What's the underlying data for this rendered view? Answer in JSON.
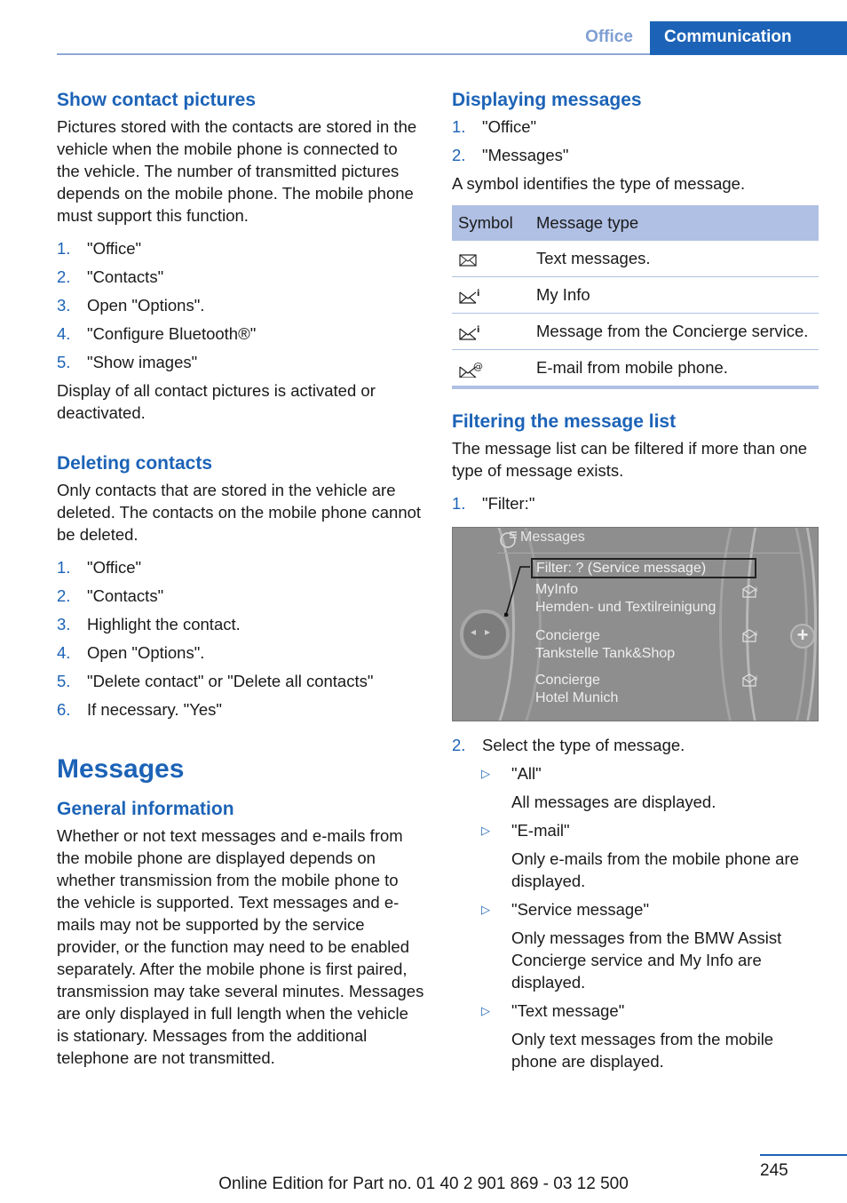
{
  "header": {
    "tab_office": "Office",
    "tab_communication": "Communication"
  },
  "left": {
    "show_contact_pictures": {
      "heading": "Show contact pictures",
      "intro": "Pictures stored with the contacts are stored in the vehicle when the mobile phone is connected to the vehicle. The number of transmitted pictures depends on the mobile phone. The mobile phone must support this function.",
      "steps": [
        {
          "num": "1.",
          "text": "\"Office\""
        },
        {
          "num": "2.",
          "text": "\"Contacts\""
        },
        {
          "num": "3.",
          "text": "Open \"Options\"."
        },
        {
          "num": "4.",
          "text": "\"Configure Bluetooth®\""
        },
        {
          "num": "5.",
          "text": "\"Show images\""
        }
      ],
      "outro": "Display of all contact pictures is activated or deactivated."
    },
    "deleting_contacts": {
      "heading": "Deleting contacts",
      "intro": "Only contacts that are stored in the vehicle are deleted. The contacts on the mobile phone cannot be deleted.",
      "steps": [
        {
          "num": "1.",
          "text": "\"Office\""
        },
        {
          "num": "2.",
          "text": "\"Contacts\""
        },
        {
          "num": "3.",
          "text": "Highlight the contact."
        },
        {
          "num": "4.",
          "text": "Open \"Options\"."
        },
        {
          "num": "5.",
          "text": "\"Delete contact\" or \"Delete all contacts\""
        },
        {
          "num": "6.",
          "text": "If necessary. \"Yes\""
        }
      ]
    },
    "messages": {
      "title": "Messages",
      "general_heading": "General information",
      "general_text": "Whether or not text messages and e-mails from the mobile phone are displayed depends on whether transmission from the mobile phone to the vehicle is supported. Text messages and e-mails may not be supported by the service provider, or the function may need to be enabled separately. After the mobile phone is first paired, transmission may take several minutes. Messages are only displayed in full length when the vehicle is stationary. Messages from the additional telephone are not transmitted."
    }
  },
  "right": {
    "displaying": {
      "heading": "Displaying messages",
      "steps": [
        {
          "num": "1.",
          "text": "\"Office\""
        },
        {
          "num": "2.",
          "text": "\"Messages\""
        }
      ],
      "note": "A symbol identifies the type of message.",
      "table": {
        "col_symbol": "Symbol",
        "col_type": "Message type",
        "rows": [
          {
            "icon": "envelope-icon",
            "type": "Text messages."
          },
          {
            "icon": "envelope-info-icon",
            "type": "My Info"
          },
          {
            "icon": "envelope-info-icon",
            "type": "Message from the Concierge service."
          },
          {
            "icon": "envelope-at-icon",
            "type": "E-mail from mobile phone."
          }
        ]
      }
    },
    "filtering": {
      "heading": "Filtering the message list",
      "intro": "The message list can be filtered if more than one type of message exists.",
      "step1": {
        "num": "1.",
        "text": "\"Filter:\""
      },
      "screen": {
        "title": "Messages",
        "filter": "Filter: ? (Service message)",
        "items": [
          {
            "line1": "MyInfo",
            "line2": "Hemden- und Textilreinigung"
          },
          {
            "line1": "Concierge",
            "line2": "Tankstelle Tank&Shop"
          },
          {
            "line1": "Concierge",
            "line2": "Hotel Munich"
          }
        ]
      },
      "step2": {
        "num": "2.",
        "text": "Select the type of message."
      },
      "options": [
        {
          "label": "\"All\"",
          "desc": "All messages are displayed."
        },
        {
          "label": "\"E-mail\"",
          "desc": "Only e-mails from the mobile phone are displayed."
        },
        {
          "label": "\"Service message\"",
          "desc": "Only messages from the BMW Assist Concierge service and My Info are displayed."
        },
        {
          "label": "\"Text message\"",
          "desc": "Only text messages from the mobile phone are displayed."
        }
      ]
    }
  },
  "footer": {
    "page_number": "245",
    "edition": "Online Edition for Part no. 01 40 2 901 869 - 03 12 500"
  }
}
